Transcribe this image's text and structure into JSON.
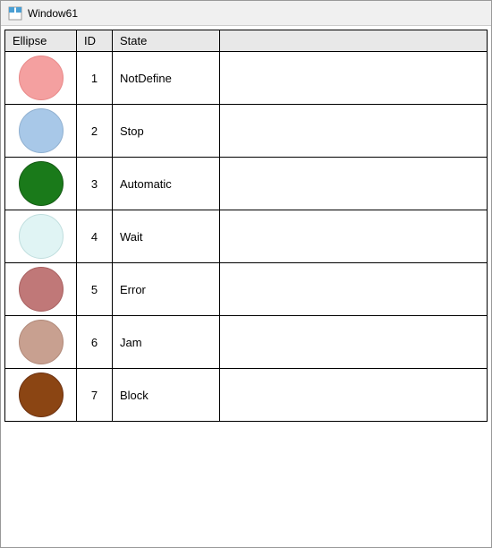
{
  "window": {
    "title": "Window61"
  },
  "table": {
    "headers": [
      "Ellipse",
      "ID",
      "State",
      ""
    ],
    "rows": [
      {
        "id": 1,
        "state": "NotDefine",
        "ellipse_color": "#f4a0a0",
        "ellipse_border": "#e88888"
      },
      {
        "id": 2,
        "state": "Stop",
        "ellipse_color": "#a8c8e8",
        "ellipse_border": "#90b0d0"
      },
      {
        "id": 3,
        "state": "Automatic",
        "ellipse_color": "#1a7a1a",
        "ellipse_border": "#145a14"
      },
      {
        "id": 4,
        "state": "Wait",
        "ellipse_color": "#e0f4f4",
        "ellipse_border": "#c0dede"
      },
      {
        "id": 5,
        "state": "Error",
        "ellipse_color": "#c07878",
        "ellipse_border": "#a86060"
      },
      {
        "id": 6,
        "state": "Jam",
        "ellipse_color": "#c8a090",
        "ellipse_border": "#b08878"
      },
      {
        "id": 7,
        "state": "Block",
        "ellipse_color": "#8b4513",
        "ellipse_border": "#6b3010"
      }
    ]
  }
}
